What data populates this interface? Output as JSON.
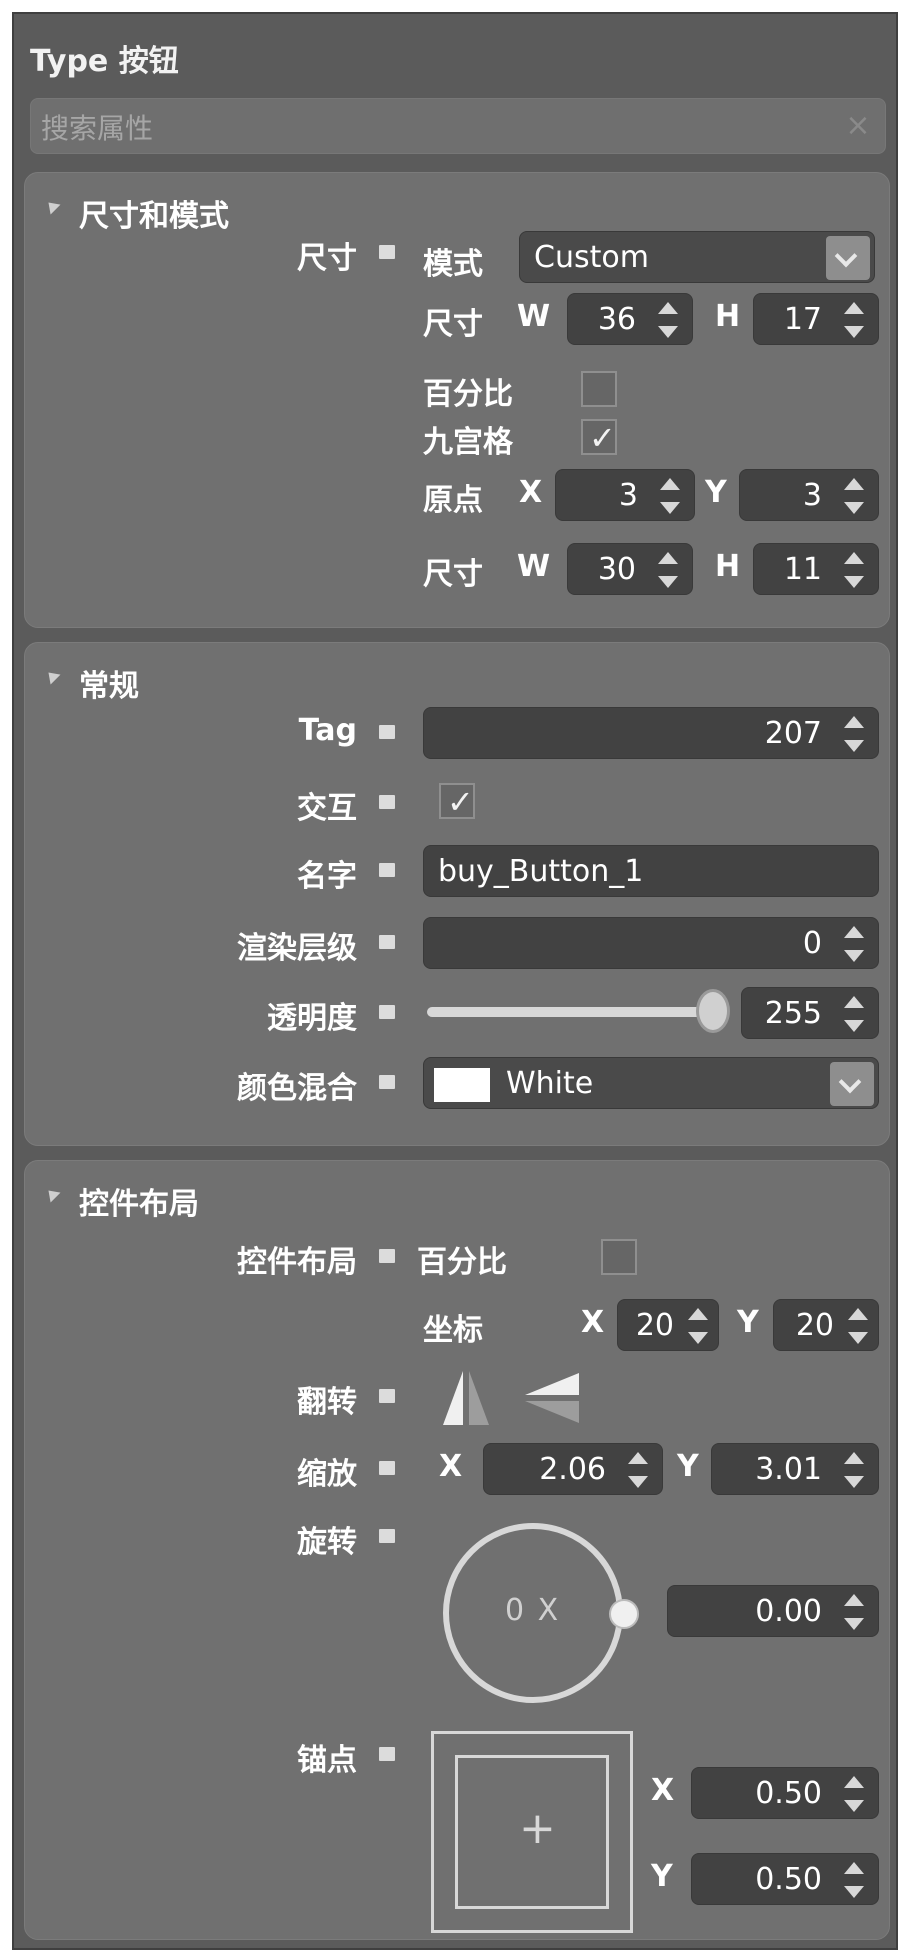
{
  "header": {
    "title": "Type 按钮",
    "search_placeholder": "搜索属性",
    "search_clear": "×"
  },
  "size_mode": {
    "section_title": "尺寸和模式",
    "size_label": "尺寸",
    "mode_label": "模式",
    "mode_value": "Custom",
    "size_row_label": "尺寸",
    "w_label": "W",
    "h_label": "H",
    "width": "36",
    "height": "17",
    "percent_label": "百分比",
    "percent_checked": false,
    "nine_slice_label": "九宫格",
    "nine_slice_checked": true,
    "checkmark": "✓",
    "origin_label": "原点",
    "x_label": "X",
    "y_label": "Y",
    "origin_x": "3",
    "origin_y": "3",
    "slice_size_label": "尺寸",
    "slice_w": "30",
    "slice_h": "11"
  },
  "general": {
    "section_title": "常规",
    "tag_label": "Tag",
    "tag_value": "207",
    "interactive_label": "交互",
    "interactive_checked": true,
    "name_label": "名字",
    "name_value": "buy_Button_1",
    "render_order_label": "渲染层级",
    "render_order_value": "0",
    "opacity_label": "透明度",
    "opacity_value": "255",
    "opacity_fraction": 1.0,
    "color_blend_label": "颜色混合",
    "color_blend_value": "White",
    "color_blend_swatch": "#ffffff"
  },
  "layout": {
    "section_title": "控件布局",
    "layout_label": "控件布局",
    "percent_label": "百分比",
    "percent_checked": false,
    "coord_label": "坐标",
    "x_label": "X",
    "y_label": "Y",
    "coord_x": "20",
    "coord_y": "20",
    "flip_label": "翻转",
    "scale_label": "缩放",
    "scale_x": "2.06",
    "scale_y": "3.01",
    "rotation_label": "旋转",
    "rotation_ring_text": "0 X",
    "rotation_value": "0.00",
    "anchor_label": "锚点",
    "anchor_x": "0.50",
    "anchor_y": "0.50",
    "anchor_plus": "+"
  },
  "colors": {
    "panel_bg": "#5b5b5b",
    "section_bg": "#707070",
    "field_bg": "#424242",
    "text": "#ffffff"
  },
  "icons": {
    "pin": "pin-icon",
    "spinner": "spinner-icon",
    "dropdown": "chevron-down-icon",
    "collapse": "collapse-triangle-icon",
    "flip_horizontal": "flip-horizontal-icon",
    "flip_vertical": "flip-vertical-icon"
  }
}
